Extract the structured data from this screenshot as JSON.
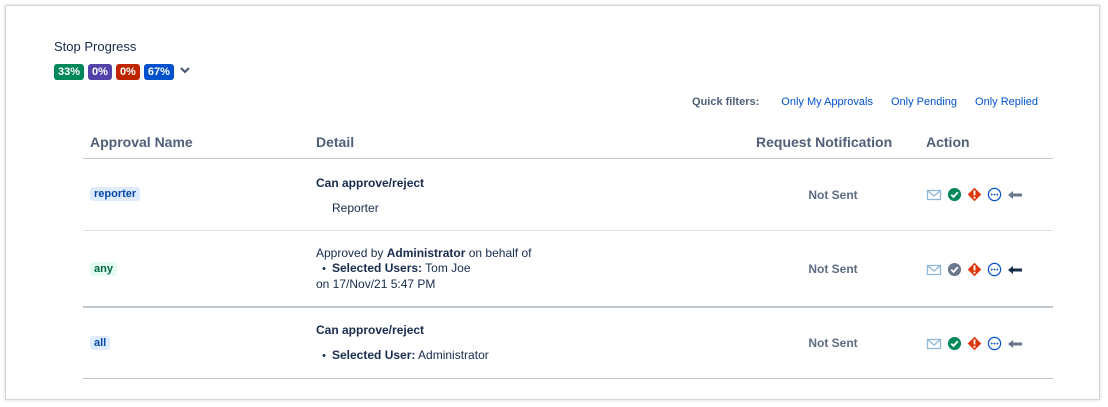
{
  "section": {
    "title": "Stop Progress",
    "progress_badges": [
      {
        "label": "33%",
        "color": "#00875a"
      },
      {
        "label": "0%",
        "color": "#5243aa"
      },
      {
        "label": "0%",
        "color": "#bf2600"
      },
      {
        "label": "67%",
        "color": "#0052cc"
      }
    ]
  },
  "quick_filters": {
    "label": "Quick filters:",
    "options": [
      "Only My Approvals",
      "Only Pending",
      "Only Replied"
    ]
  },
  "table": {
    "headers": [
      "Approval Name",
      "Detail",
      "Request Notification",
      "Action"
    ],
    "rows": [
      {
        "approval_name": "reporter",
        "tag_color": "blue",
        "detail_heading": "Can approve/reject",
        "detail_line": "Reporter",
        "notification": "Not Sent",
        "approve_icon_state": "active"
      },
      {
        "approval_name": "any",
        "tag_color": "green",
        "detail_prefix": "Approved by ",
        "detail_approver": "Administrator",
        "detail_suffix": " on behalf of",
        "selected_users_label": "Selected Users:",
        "selected_users_value": " Tom Joe",
        "detail_date": "on 17/Nov/21 5:47 PM",
        "notification": "Not Sent",
        "approve_icon_state": "done"
      },
      {
        "approval_name": "all",
        "tag_color": "blue",
        "detail_heading": "Can approve/reject",
        "selected_user_label": "Selected User:",
        "selected_user_value": " Administrator",
        "notification": "Not Sent",
        "approve_icon_state": "active"
      }
    ]
  },
  "action_icons": [
    "mail-icon",
    "approve-icon",
    "reject-icon",
    "more-icon",
    "reply-icon"
  ],
  "colors": {
    "link": "#0052cc",
    "approve_green": "#00875a",
    "approve_done_gray": "#6b778c",
    "reject_red": "#de350b",
    "more_blue": "#0052cc",
    "mail_light_blue": "#8fb8d9"
  }
}
